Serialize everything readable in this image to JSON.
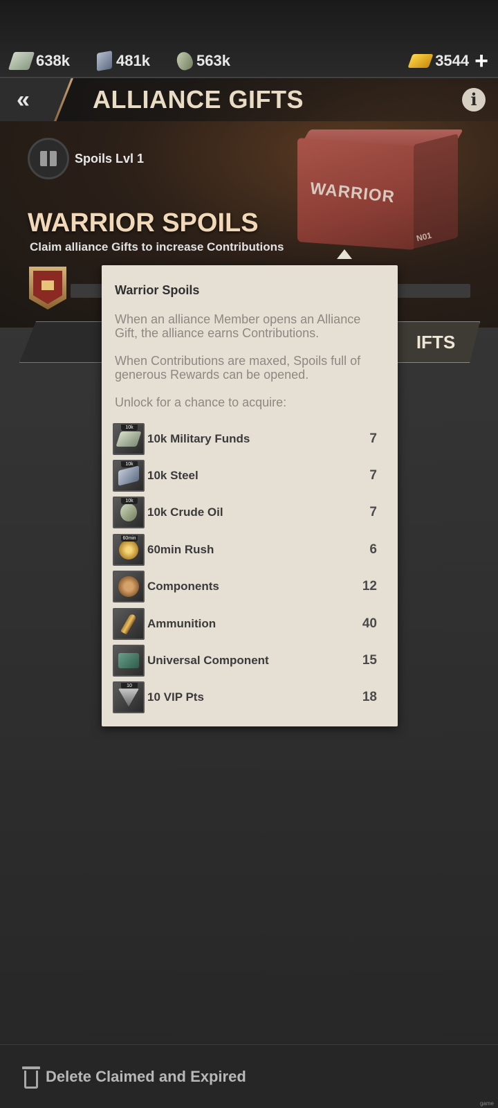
{
  "resources": {
    "funds": "638k",
    "steel": "481k",
    "oil": "563k",
    "gold": "3544",
    "gold_plus": "+"
  },
  "header": {
    "back_label": "«",
    "title": "ALLIANCE GIFTS",
    "info_label": "i"
  },
  "hero": {
    "spoils_level": "Spoils Lvl 1",
    "crate_label": "WARRIOR",
    "crate_number": "N01",
    "title": "WARRIOR SPOILS",
    "subtitle": "Claim alliance Gifts to increase Contributions",
    "progress_fraction": 0.0
  },
  "tabs": {
    "right_partial": "IFTS"
  },
  "tooltip": {
    "title": "Warrior Spoils",
    "p1": "When an alliance Member opens an Alliance Gift, the alliance earns Contributions.",
    "p2": "When Contributions are maxed, Spoils full of generous Rewards can be opened.",
    "p3": "Unlock for a chance to acquire:",
    "rewards": [
      {
        "name": "10k Military Funds",
        "qty": "7",
        "tag": "10k",
        "icon": "military-funds-icon"
      },
      {
        "name": "10k Steel",
        "qty": "7",
        "tag": "10k",
        "icon": "steel-icon"
      },
      {
        "name": "10k Crude Oil",
        "qty": "7",
        "tag": "10k",
        "icon": "crude-oil-icon"
      },
      {
        "name": "60min Rush",
        "qty": "6",
        "tag": "60min",
        "icon": "rush-icon"
      },
      {
        "name": "Components",
        "qty": "12",
        "tag": "",
        "icon": "gear-component-icon"
      },
      {
        "name": "Ammunition",
        "qty": "40",
        "tag": "",
        "icon": "ammunition-icon"
      },
      {
        "name": "Universal Component",
        "qty": "15",
        "tag": "",
        "icon": "universal-component-icon"
      },
      {
        "name": "10 VIP Pts",
        "qty": "18",
        "tag": "10",
        "icon": "vip-points-icon"
      }
    ]
  },
  "footer": {
    "delete_label": "Delete Claimed and Expired"
  },
  "watermark": "game"
}
